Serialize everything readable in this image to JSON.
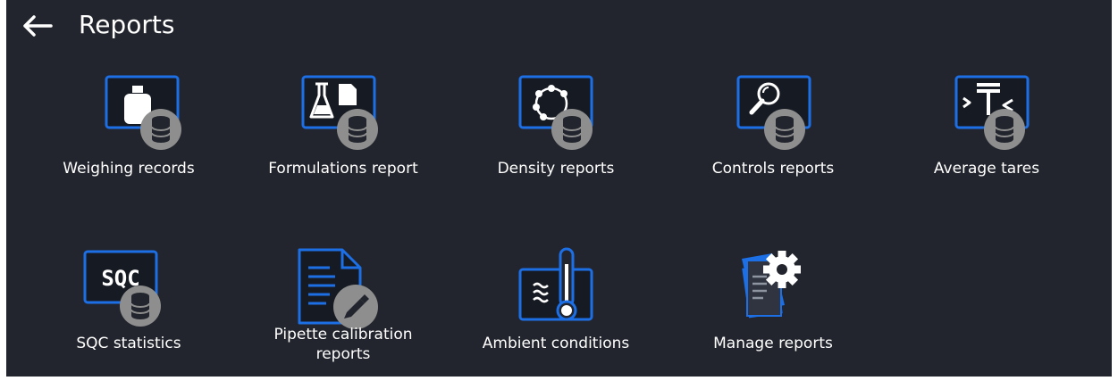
{
  "header": {
    "title": "Reports"
  },
  "tiles": [
    {
      "label": "Weighing records"
    },
    {
      "label": "Formulations report"
    },
    {
      "label": "Density reports"
    },
    {
      "label": "Controls reports"
    },
    {
      "label": "Average tares"
    },
    {
      "label": "SQC statistics",
      "icon_text": "SQC"
    },
    {
      "label_line1": "Pipette calibration",
      "label_line2": "reports"
    },
    {
      "label": "Ambient conditions"
    },
    {
      "label": "Manage reports"
    }
  ],
  "colors": {
    "background": "#22252d",
    "accent": "#1d6fe6",
    "badge": "#8e8e8e",
    "text": "#ffffff"
  }
}
